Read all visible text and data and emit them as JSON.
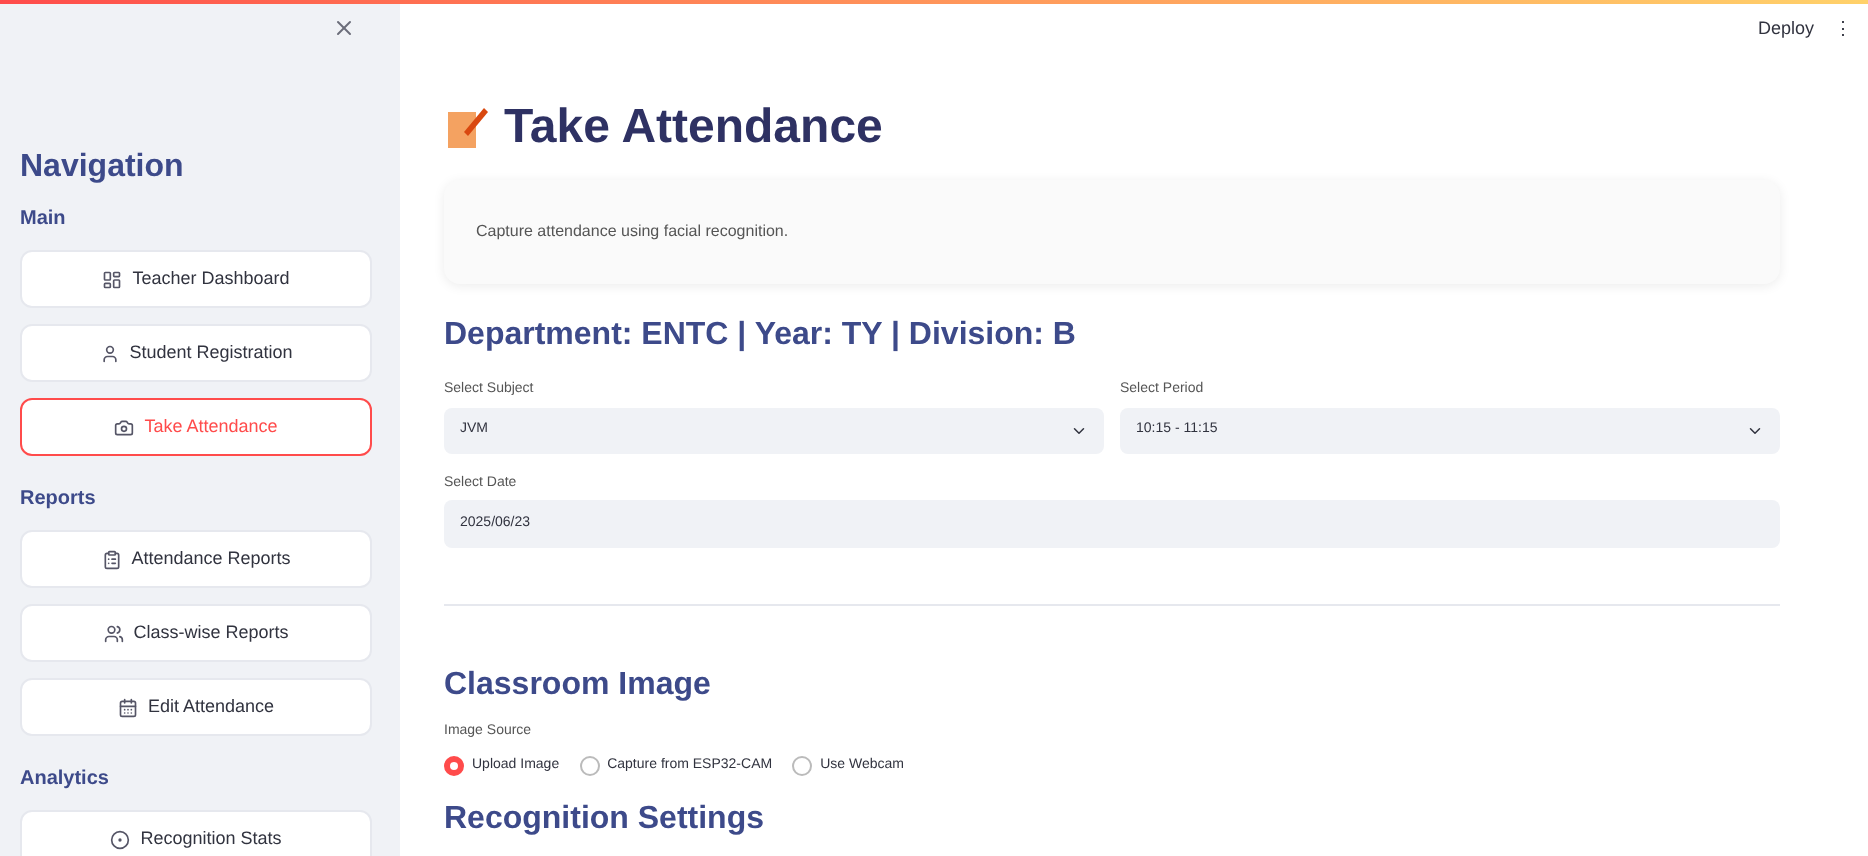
{
  "sidebar": {
    "title": "Navigation",
    "sections": [
      {
        "heading": "Main",
        "items": [
          {
            "label": "Teacher Dashboard",
            "selected": false
          },
          {
            "label": "Student Registration",
            "selected": false
          },
          {
            "label": "Take Attendance",
            "selected": true
          }
        ]
      },
      {
        "heading": "Reports",
        "items": [
          {
            "label": "Attendance Reports",
            "selected": false
          },
          {
            "label": "Class-wise Reports",
            "selected": false
          },
          {
            "label": "Edit Attendance",
            "selected": false
          }
        ]
      },
      {
        "heading": "Analytics",
        "items": [
          {
            "label": "Recognition Stats",
            "selected": false
          }
        ]
      }
    ]
  },
  "top_bar": {
    "deploy": "Deploy",
    "menu": "⋮"
  },
  "page": {
    "title": "Take Attendance",
    "caption": "Capture attendance using facial recognition.",
    "context": "Department: ENTC | Year: TY | Division: B",
    "fields": [
      {
        "kind": "select",
        "label": "Select Subject",
        "value": "JVM"
      },
      {
        "kind": "select",
        "label": "Select Period",
        "value": "10:15 - 11:15"
      },
      {
        "kind": "date",
        "label": "Select Date",
        "value": "2025/06/23"
      }
    ],
    "classroom_heading": "Classroom Image",
    "image_source": {
      "label": "Image Source",
      "options": [
        {
          "label": "Upload Image",
          "selected": true
        },
        {
          "label": "Capture from ESP32-CAM",
          "selected": false
        },
        {
          "label": "Use Webcam",
          "selected": false
        }
      ]
    },
    "settings_heading": "Recognition Settings"
  }
}
